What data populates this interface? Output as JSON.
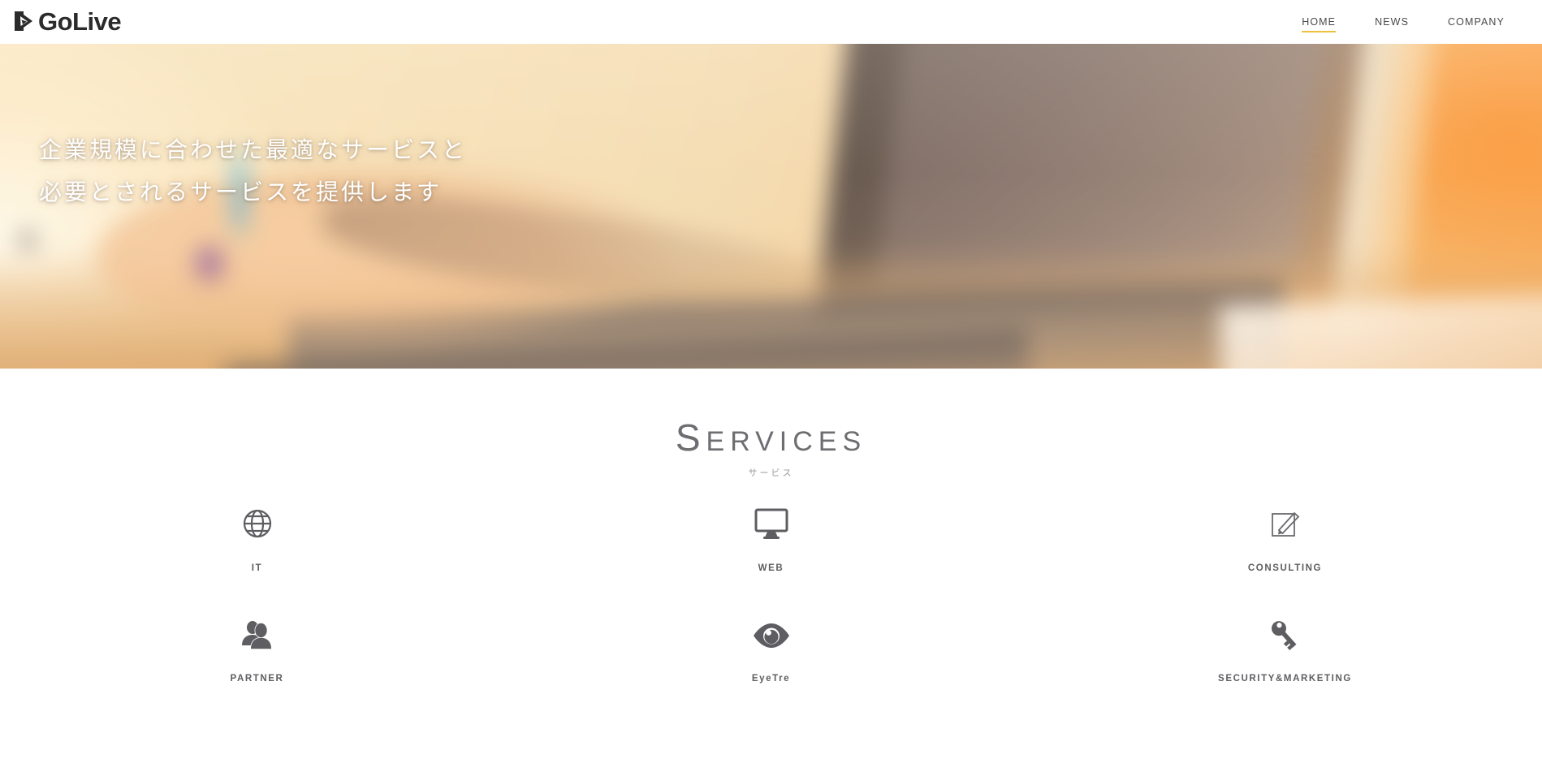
{
  "site": {
    "brand_name": "GoLive",
    "accent_color": "#f0c040",
    "icon_color": "#5e5e62"
  },
  "header": {
    "logo_text": "GoLive",
    "logo_mark": "golive-arrow-mark",
    "nav": [
      {
        "label": "HOME",
        "active": true
      },
      {
        "label": "NEWS",
        "active": false
      },
      {
        "label": "COMPANY",
        "active": false
      }
    ]
  },
  "hero": {
    "background": "blurred-laptop-desk-photo-warm",
    "line1": "企業規模に合わせた最適なサービスと",
    "line2": "必要とされるサービスを提供します"
  },
  "services": {
    "title_first": "S",
    "title_rest": "ERVICES",
    "subtitle": "サービス",
    "items": [
      {
        "label": "IT",
        "icon": "globe-icon"
      },
      {
        "label": "WEB",
        "icon": "monitor-icon"
      },
      {
        "label": "CONSULTING",
        "icon": "pencil-square-icon"
      },
      {
        "label": "PARTNER",
        "icon": "users-icon"
      },
      {
        "label": "EyeTre",
        "icon": "eye-icon"
      },
      {
        "label": "SECURITY&MARKETING",
        "icon": "key-icon"
      }
    ]
  }
}
